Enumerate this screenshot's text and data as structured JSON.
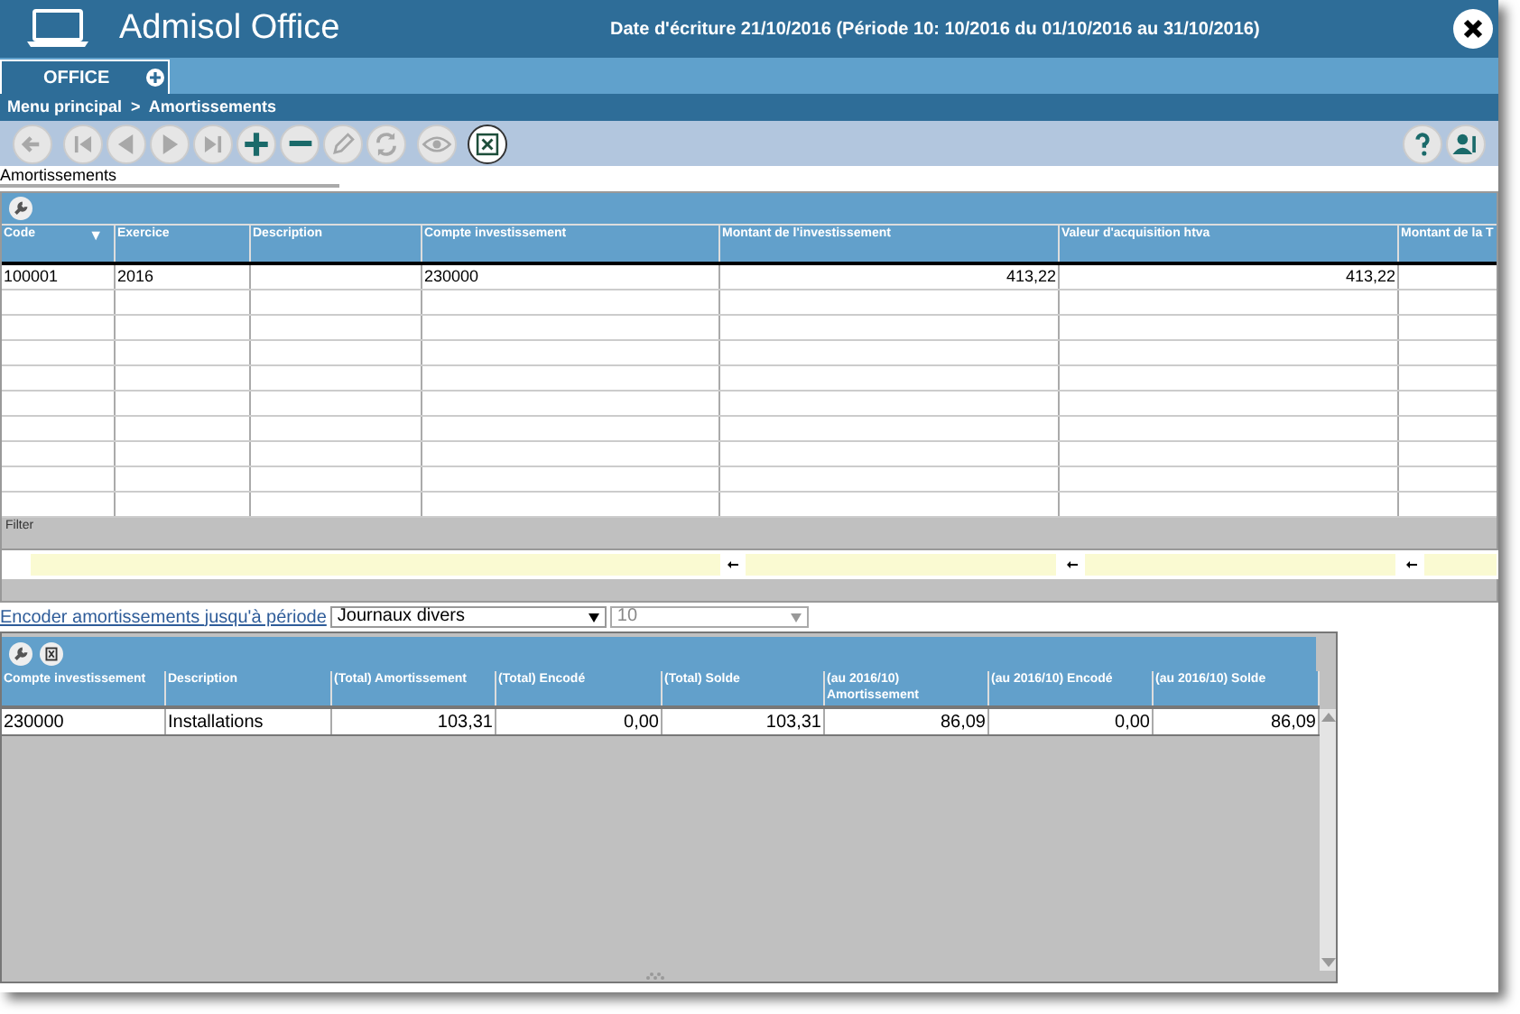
{
  "app": {
    "title": "Admisol Office",
    "info": "Date d'écriture 21/10/2016 (Période 10: 10/2016 du 01/10/2016 au 31/10/2016)"
  },
  "tabs": [
    {
      "label": "OFFICE",
      "selected": true
    }
  ],
  "breadcrumb": "Menu principal  >  Amortissements",
  "toolbar": [
    {
      "kind": "back",
      "disabled": true
    },
    {
      "kind": "first",
      "disabled": true
    },
    {
      "kind": "prev",
      "disabled": true
    },
    {
      "kind": "next",
      "disabled": true
    },
    {
      "kind": "last",
      "disabled": true
    },
    {
      "kind": "add",
      "disabled": false
    },
    {
      "kind": "remove",
      "disabled": false
    },
    {
      "kind": "edit",
      "disabled": true
    },
    {
      "kind": "refresh",
      "disabled": true
    },
    {
      "kind": "view",
      "disabled": true
    },
    {
      "kind": "excel",
      "disabled": false
    }
  ],
  "toolbar_right": [
    {
      "kind": "help"
    },
    {
      "kind": "user"
    }
  ],
  "section_label": "Amortissements",
  "grid": {
    "columns": [
      {
        "label": "Code",
        "sort_indicator": "▼"
      },
      {
        "label": "Exercice"
      },
      {
        "label": "Description"
      },
      {
        "label": "Compte investissement"
      },
      {
        "label": "Montant de l'investissement"
      },
      {
        "label": "Valeur d'acquisition htva"
      },
      {
        "label": "Montant de la T"
      }
    ],
    "rows": [
      {
        "cells": [
          "100001",
          "2016",
          "",
          "230000",
          "413,22",
          "413,22",
          ""
        ]
      }
    ],
    "filter_label": "Filter",
    "filters": [
      {
        "kind": "text"
      },
      {
        "kind": "text"
      },
      {
        "kind": "text"
      },
      {
        "kind": "text"
      },
      {
        "kind": "range"
      },
      {
        "kind": "range"
      },
      {
        "kind": "range"
      }
    ]
  },
  "encode": {
    "link": "Encoder amortissements jusqu'à période",
    "journal": "Journaux divers",
    "period": "10",
    "period_disabled": true
  },
  "summary": {
    "columns": [
      {
        "label": "Compte investissement"
      },
      {
        "label": "Description"
      },
      {
        "label": "(Total) Amortissement"
      },
      {
        "label": "(Total) Encodé"
      },
      {
        "label": "(Total) Solde"
      },
      {
        "label": "(au 2016/10) Amortissement"
      },
      {
        "label": "(au 2016/10) Encodé"
      },
      {
        "label": "(au 2016/10) Solde"
      }
    ],
    "rows": [
      {
        "cells": [
          "230000",
          "Installations",
          "103,31",
          "0,00",
          "103,31",
          "86,09",
          "0,00",
          "86,09"
        ]
      }
    ]
  }
}
